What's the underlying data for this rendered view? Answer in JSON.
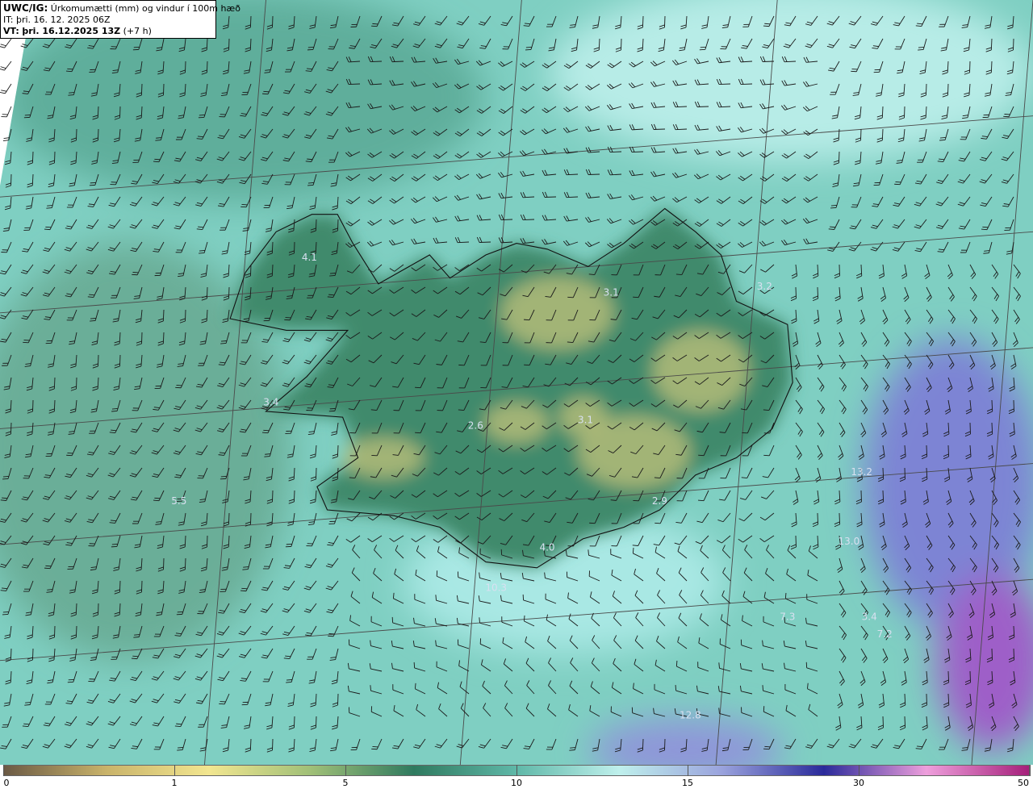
{
  "header": {
    "product": "UWC/IG:",
    "title": "Úrkomumætti (mm) og vindur í 100m hæð",
    "it_label": "IT:",
    "it_value": "þri. 16. 12. 2025 06Z",
    "vt_label": "VT:",
    "vt_value": "þri. 16.12.2025 13Z",
    "vt_offset": "(+7 h)"
  },
  "map_values": [
    {
      "text": "4.1",
      "lon": -22.95,
      "lat": 66.05
    },
    {
      "text": "3.1",
      "lon": -17.05,
      "lat": 65.75
    },
    {
      "text": "3.2",
      "lon": -14.05,
      "lat": 65.8
    },
    {
      "text": "3.4",
      "lon": -23.7,
      "lat": 64.8
    },
    {
      "text": "2.6",
      "lon": -19.7,
      "lat": 64.6
    },
    {
      "text": "3.1",
      "lon": -17.55,
      "lat": 64.65
    },
    {
      "text": "13.2",
      "lon": -12.15,
      "lat": 64.2
    },
    {
      "text": "5.5",
      "lon": -25.5,
      "lat": 63.95
    },
    {
      "text": "2.9",
      "lon": -16.1,
      "lat": 63.95
    },
    {
      "text": "13.0",
      "lon": -12.4,
      "lat": 63.6
    },
    {
      "text": "4.0",
      "lon": -18.3,
      "lat": 63.55
    },
    {
      "text": "10.3",
      "lon": -19.3,
      "lat": 63.2
    },
    {
      "text": "7.3",
      "lon": -13.6,
      "lat": 62.95
    },
    {
      "text": "3.4",
      "lon": -12.0,
      "lat": 62.95
    },
    {
      "text": "7.2",
      "lon": -11.7,
      "lat": 62.8
    },
    {
      "text": "12.8",
      "lon": -15.5,
      "lat": 62.1
    }
  ],
  "colorbar": {
    "ticks": [
      {
        "label": "0",
        "value": 0
      },
      {
        "label": "1",
        "value": 1
      },
      {
        "label": "5",
        "value": 5
      },
      {
        "label": "10",
        "value": 10
      },
      {
        "label": "15",
        "value": 15
      },
      {
        "label": "30",
        "value": 30
      },
      {
        "label": "50",
        "value": 50
      }
    ],
    "colors": [
      "#6b5a45",
      "#c9b36a",
      "#f2e690",
      "#9fbf77",
      "#2f7a5f",
      "#5fb8a8",
      "#bff0ec",
      "#9aa3dd",
      "#2a2a9a",
      "#ee9fdc",
      "#a5207a"
    ]
  },
  "style": {
    "sea_field": "#7fcfc2",
    "land_field": "#3f8a6c",
    "heavy_precip": "#6a6ac8",
    "coast_color": "#111111",
    "grid_color": "#4a4a4a",
    "barb_color": "#1a1a1a",
    "label_color": "#d8e0f0"
  },
  "wind": {
    "regions": [
      {
        "name": "west",
        "lon_min": -28,
        "lon_max": -22,
        "lat_min": 62,
        "lat_max": 67.5,
        "dir_deg": 200,
        "speed_kt": 25
      },
      {
        "name": "north",
        "lon_min": -22,
        "lon_max": -13,
        "lat_min": 66.2,
        "lat_max": 67.8,
        "dir_deg": 250,
        "speed_kt": 25
      },
      {
        "name": "interior",
        "lon_min": -22,
        "lon_max": -13.5,
        "lat_min": 63.6,
        "lat_max": 66.2,
        "dir_deg": 220,
        "speed_kt": 15
      },
      {
        "name": "south",
        "lon_min": -22,
        "lon_max": -13,
        "lat_min": 62,
        "lat_max": 63.6,
        "dir_deg": 300,
        "speed_kt": 15
      },
      {
        "name": "east",
        "lon_min": -13.5,
        "lon_max": -9,
        "lat_min": 62,
        "lat_max": 66.2,
        "dir_deg": 160,
        "speed_kt": 20
      }
    ]
  }
}
